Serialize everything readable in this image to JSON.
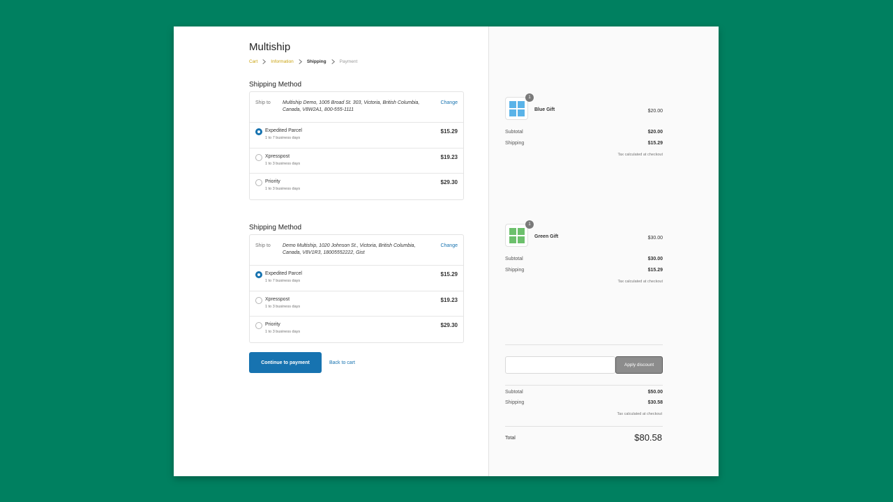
{
  "shop": {
    "title": "Multiship"
  },
  "breadcrumb": [
    {
      "label": "Cart",
      "state": "done"
    },
    {
      "label": "Information",
      "state": "done"
    },
    {
      "label": "Shipping",
      "state": "current"
    },
    {
      "label": "Payment",
      "state": "upcoming"
    }
  ],
  "shipments": [
    {
      "title": "Shipping Method",
      "ship_to_label": "Ship to",
      "address": "Multiship Demo, 1005 Broad St. 303, Victoria, British Columbia, Canada, V8W2A1, 800-555-1111",
      "change_label": "Change",
      "rates": [
        {
          "name": "Expedited Parcel",
          "days": "1 to 7 business days",
          "price": "$15.29",
          "selected": true
        },
        {
          "name": "Xpresspost",
          "days": "1 to 3 business days",
          "price": "$19.23",
          "selected": false
        },
        {
          "name": "Priority",
          "days": "1 to 3 business days",
          "price": "$29.30",
          "selected": false
        }
      ]
    },
    {
      "title": "Shipping Method",
      "ship_to_label": "Ship to",
      "address": "Demo Multiship, 1020 Johnson St., Victoria, British Columbia, Canada, V8V1R3, 18005552222, Gist",
      "change_label": "Change",
      "rates": [
        {
          "name": "Expedited Parcel",
          "days": "1 to 7 business days",
          "price": "$15.29",
          "selected": true
        },
        {
          "name": "Xpresspost",
          "days": "1 to 3 business days",
          "price": "$19.23",
          "selected": false
        },
        {
          "name": "Priority",
          "days": "1 to 3 business days",
          "price": "$29.30",
          "selected": false
        }
      ]
    }
  ],
  "actions": {
    "continue_label": "Continue to payment",
    "back_label": "Back to cart"
  },
  "summary": {
    "products": [
      {
        "name": "Blue Gift",
        "quantity": "1",
        "price": "$20.00",
        "color": "#5ab3e8",
        "subtotal_label": "Subtotal",
        "subtotal": "$20.00",
        "shipping_label": "Shipping",
        "shipping": "$15.29",
        "tax_note": "Tax calculated at checkout"
      },
      {
        "name": "Green Gift",
        "quantity": "1",
        "price": "$30.00",
        "color": "#6cc06c",
        "subtotal_label": "Subtotal",
        "subtotal": "$30.00",
        "shipping_label": "Shipping",
        "shipping": "$15.29",
        "tax_note": "Tax calculated at checkout"
      }
    ],
    "discount": {
      "placeholder": "",
      "button_label": "Apply discount"
    },
    "subtotal_label": "Subtotal",
    "subtotal": "$50.00",
    "shipping_label": "Shipping",
    "shipping": "$30.58",
    "tax_note": "Tax calculated at checkout",
    "total_label": "Total",
    "total": "$80.58"
  }
}
